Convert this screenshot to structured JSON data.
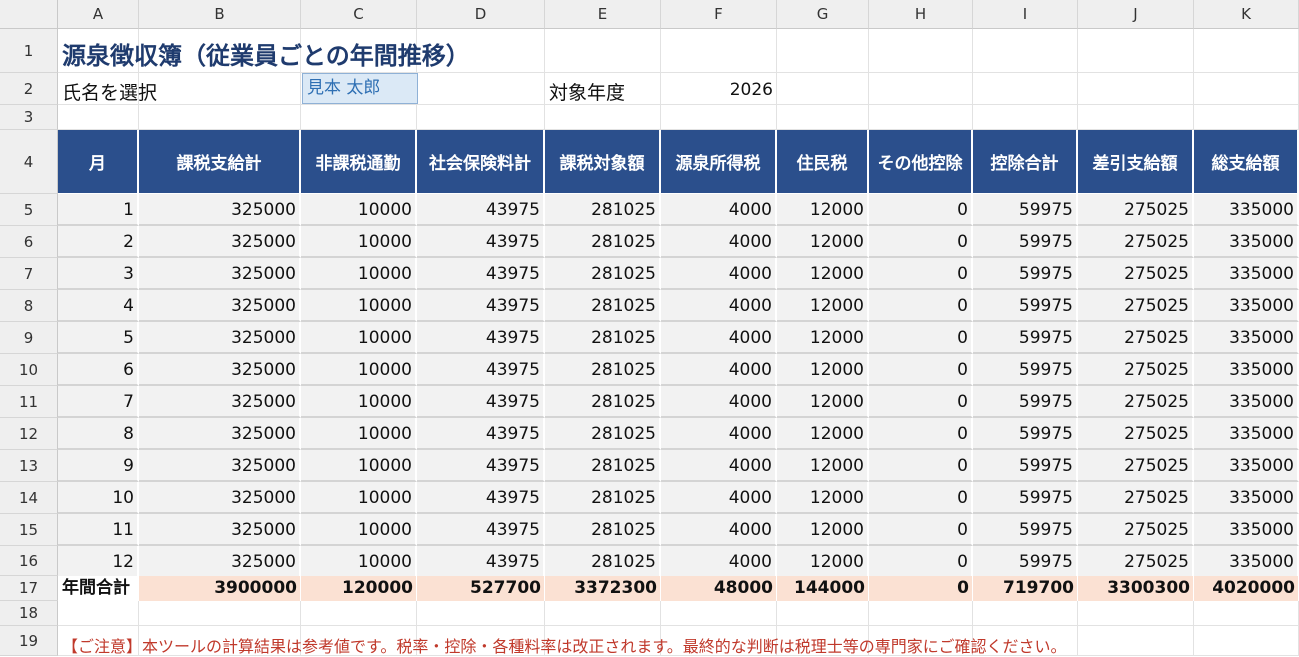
{
  "columns": [
    "A",
    "B",
    "C",
    "D",
    "E",
    "F",
    "G",
    "H",
    "I",
    "J",
    "K"
  ],
  "rows": [
    "1",
    "2",
    "3",
    "4",
    "5",
    "6",
    "7",
    "8",
    "9",
    "10",
    "11",
    "12",
    "13",
    "14",
    "15",
    "16",
    "17",
    "18",
    "19"
  ],
  "title": "源泉徴収簿（従業員ごとの年間推移）",
  "select_label": "氏名を選択",
  "selected_name": "見本 太郎",
  "year_label": "対象年度",
  "year_value": "2026",
  "table": {
    "headers": [
      "月",
      "課税支給計",
      "非課税通勤",
      "社会保険料計",
      "課税対象額",
      "源泉所得税",
      "住民税",
      "その他控除",
      "控除合計",
      "差引支給額",
      "総支給額"
    ],
    "rows": [
      [
        "1",
        "325000",
        "10000",
        "43975",
        "281025",
        "4000",
        "12000",
        "0",
        "59975",
        "275025",
        "335000"
      ],
      [
        "2",
        "325000",
        "10000",
        "43975",
        "281025",
        "4000",
        "12000",
        "0",
        "59975",
        "275025",
        "335000"
      ],
      [
        "3",
        "325000",
        "10000",
        "43975",
        "281025",
        "4000",
        "12000",
        "0",
        "59975",
        "275025",
        "335000"
      ],
      [
        "4",
        "325000",
        "10000",
        "43975",
        "281025",
        "4000",
        "12000",
        "0",
        "59975",
        "275025",
        "335000"
      ],
      [
        "5",
        "325000",
        "10000",
        "43975",
        "281025",
        "4000",
        "12000",
        "0",
        "59975",
        "275025",
        "335000"
      ],
      [
        "6",
        "325000",
        "10000",
        "43975",
        "281025",
        "4000",
        "12000",
        "0",
        "59975",
        "275025",
        "335000"
      ],
      [
        "7",
        "325000",
        "10000",
        "43975",
        "281025",
        "4000",
        "12000",
        "0",
        "59975",
        "275025",
        "335000"
      ],
      [
        "8",
        "325000",
        "10000",
        "43975",
        "281025",
        "4000",
        "12000",
        "0",
        "59975",
        "275025",
        "335000"
      ],
      [
        "9",
        "325000",
        "10000",
        "43975",
        "281025",
        "4000",
        "12000",
        "0",
        "59975",
        "275025",
        "335000"
      ],
      [
        "10",
        "325000",
        "10000",
        "43975",
        "281025",
        "4000",
        "12000",
        "0",
        "59975",
        "275025",
        "335000"
      ],
      [
        "11",
        "325000",
        "10000",
        "43975",
        "281025",
        "4000",
        "12000",
        "0",
        "59975",
        "275025",
        "335000"
      ],
      [
        "12",
        "325000",
        "10000",
        "43975",
        "281025",
        "4000",
        "12000",
        "0",
        "59975",
        "275025",
        "335000"
      ]
    ],
    "total_label": "年間合計",
    "totals": [
      "3900000",
      "120000",
      "527700",
      "3372300",
      "48000",
      "144000",
      "0",
      "719700",
      "3300300",
      "4020000"
    ]
  },
  "note": "【ご注意】本ツールの計算結果は参考値です。税率・控除・各種料率は改正されます。最終的な判断は税理士等の専門家にご確認ください。",
  "colors": {
    "header_bg": "#2b4f8c",
    "title": "#1f3b6e",
    "total_bg": "#fbe1d3",
    "note": "#c0392b",
    "selection_bg": "#dbe9f6"
  }
}
